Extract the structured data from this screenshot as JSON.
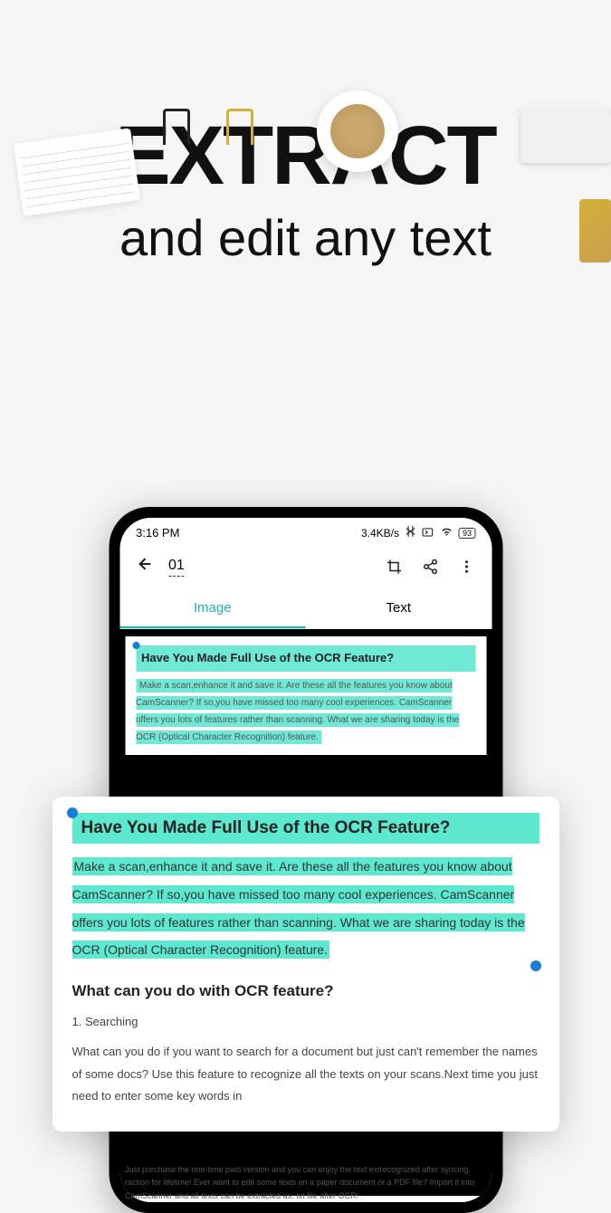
{
  "marketing": {
    "headline": "EXTRACT",
    "subheadline": "and edit any text"
  },
  "statusBar": {
    "time": "3:16 PM",
    "dataRate": "3.4KB/s",
    "battery": "93"
  },
  "appHeader": {
    "pageNumber": "01"
  },
  "tabs": {
    "image": "Image",
    "text": "Text"
  },
  "document": {
    "title": "Have You Made Full Use of the OCR Feature?",
    "intro": "Make a scan,enhance it and save it. Are these all the features you know about CamScanner? If so,you have missed too many cool experiences. CamScanner offers you lots of features rather than scanning. What we are sharing today is the OCR (Optical Character Recognition) feature.",
    "sectionTitle": "What can you do with OCR feature?",
    "item1Label": "1. Searching",
    "item1Text": "What can you do if you want to search for a document but just can't remember the names of some docs? Use this feature to recognize all the texts on your scans.Next time you just need to enter some key words in",
    "bottomText1": "Just purchase the one-time paid version and you can enjoy the text extrecognized after syncing.",
    "bottomText2": "raction for lifetime! Ever want to edit some texts on a paper document or a PDF file? Import it into CamScanner and all texts can be extracted as. txt file after OCR!"
  }
}
